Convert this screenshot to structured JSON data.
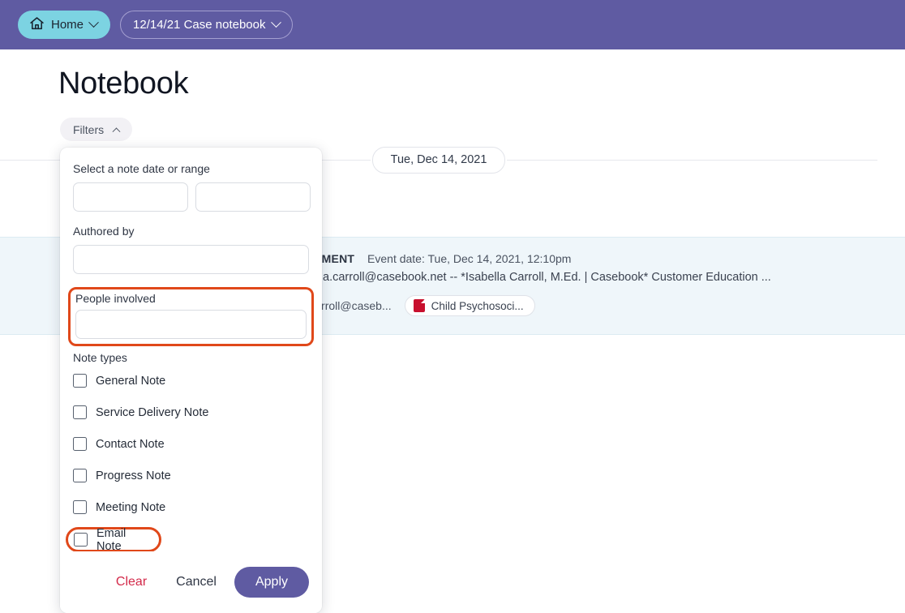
{
  "topbar": {
    "background": "#5f5ba2",
    "home": {
      "label": "Home",
      "icon": "home-icon",
      "background": "#7cd3e2"
    },
    "breadcrumb": {
      "label": "12/14/21 Case notebook"
    }
  },
  "page": {
    "title": "Notebook",
    "filters_button": {
      "label": "Filters",
      "icon": "chevron-up-icon"
    }
  },
  "timeline": {
    "date_pill": "Tue, Dec 14, 2021",
    "note": {
      "tag": "ATTACHMENT",
      "event_date": "Event date: Tue, Dec 14, 2021, 12:10pm",
      "body": "er isabella.carroll@casebook.net -- *Isabella Carroll, M.Ed. | Casebook* Customer Education ...",
      "person_chip": "abella.carroll@caseb...",
      "attachment_chip": {
        "label": "Child Psychosoci...",
        "icon": "pdf-file-icon"
      }
    }
  },
  "filter_panel": {
    "date_range": {
      "label": "Select a note date or range",
      "from_value": "",
      "to_value": "",
      "from_placeholder": "",
      "to_placeholder": ""
    },
    "authored_by": {
      "label": "Authored by",
      "value": "",
      "placeholder": ""
    },
    "people_involved": {
      "label": "People involved",
      "value": "",
      "placeholder": "",
      "highlighted": true,
      "highlight_color": "#e0481a"
    },
    "note_types": {
      "label": "Note types",
      "options": [
        {
          "label": "General Note",
          "checked": false,
          "highlighted": false
        },
        {
          "label": "Service Delivery Note",
          "checked": false,
          "highlighted": false
        },
        {
          "label": "Contact Note",
          "checked": false,
          "highlighted": false
        },
        {
          "label": "Progress Note",
          "checked": false,
          "highlighted": false
        },
        {
          "label": "Meeting Note",
          "checked": false,
          "highlighted": false
        },
        {
          "label": "Email Note",
          "checked": false,
          "highlighted": true
        }
      ]
    },
    "actions": {
      "clear": "Clear",
      "cancel": "Cancel",
      "apply": "Apply",
      "apply_color": "#5f5ba2",
      "clear_color": "#d32a4a"
    }
  }
}
